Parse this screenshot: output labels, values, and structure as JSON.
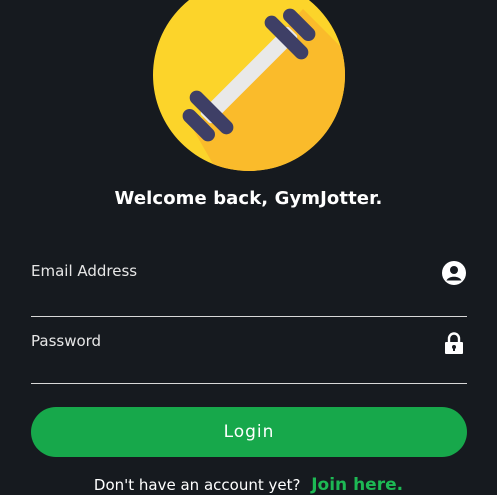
{
  "app": {
    "welcome_text": "Welcome back, GymJotter.",
    "logo_icon": "dumbbell-icon"
  },
  "form": {
    "email": {
      "label": "Email Address",
      "value": "",
      "icon": "user-circle-icon"
    },
    "password": {
      "label": "Password",
      "value": "",
      "icon": "lock-icon"
    },
    "login_label": "Login"
  },
  "signup": {
    "prompt": "Don't have an account yet?",
    "link_label": "Join here."
  },
  "colors": {
    "background": "#161a1f",
    "accent_green": "#17a84b",
    "link_green": "#1db954",
    "logo_yellow": "#fcd42a",
    "logo_shadow": "#f9b62c",
    "dumbbell_plate": "#3e3f66"
  }
}
